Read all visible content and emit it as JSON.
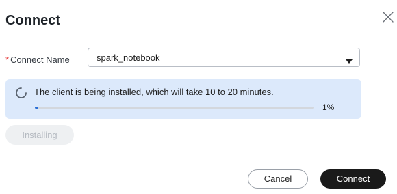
{
  "dialog": {
    "title": "Connect",
    "close_icon": "close-icon"
  },
  "form": {
    "required_mark": "*",
    "connect_name_label": "Connect Name",
    "connect_name_value": "spark_notebook",
    "dropdown_icon": "caret-down-icon"
  },
  "install_notice": {
    "spinner_icon": "loading-spinner-icon",
    "message": "The client is being installed, which will take 10 to 20 minutes.",
    "progress_percent": 1,
    "progress_label": "1%",
    "background_color": "#dce9fb",
    "progress_color": "#2b6fd6"
  },
  "installing_button": {
    "label": "Installing",
    "disabled": true
  },
  "footer": {
    "cancel_label": "Cancel",
    "connect_label": "Connect",
    "primary_color": "#1a1a1a"
  }
}
